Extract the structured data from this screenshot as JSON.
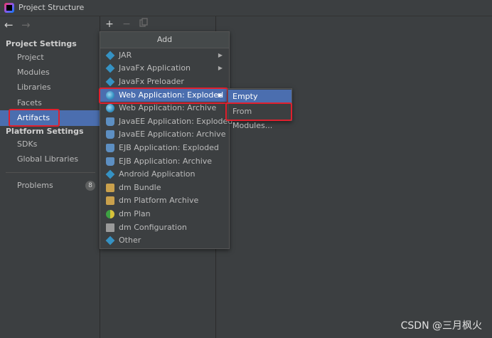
{
  "window": {
    "title": "Project Structure",
    "app_icon": "intellij-idea-icon"
  },
  "nav": {
    "back_icon": "arrow-left-icon",
    "forward_icon": "arrow-right-icon"
  },
  "sidebar": {
    "project_settings_header": "Project Settings",
    "project_items": [
      {
        "label": "Project"
      },
      {
        "label": "Modules"
      },
      {
        "label": "Libraries"
      },
      {
        "label": "Facets"
      },
      {
        "label": "Artifacts",
        "selected": true
      }
    ],
    "platform_settings_header": "Platform Settings",
    "platform_items": [
      {
        "label": "SDKs"
      },
      {
        "label": "Global Libraries"
      }
    ],
    "problems": {
      "label": "Problems",
      "count": "8"
    }
  },
  "toolbar": {
    "add_icon": "+",
    "remove_icon": "−",
    "copy_icon": "copy-icon"
  },
  "add_menu": {
    "title": "Add",
    "items": [
      {
        "label": "JAR",
        "icon": "jar-diamond-icon",
        "has_submenu": true
      },
      {
        "label": "JavaFx Application",
        "icon": "javafx-diamond-icon",
        "has_submenu": true
      },
      {
        "label": "JavaFx Preloader",
        "icon": "javafx-diamond-icon"
      },
      {
        "label": "Web Application: Exploded",
        "icon": "web-globe-icon",
        "has_submenu": true,
        "highlighted": true
      },
      {
        "label": "Web Application: Archive",
        "icon": "web-globe-icon"
      },
      {
        "label": "JavaEE Application: Exploded",
        "icon": "javaee-icon"
      },
      {
        "label": "JavaEE Application: Archive",
        "icon": "javaee-icon"
      },
      {
        "label": "EJB Application: Exploded",
        "icon": "ejb-icon"
      },
      {
        "label": "EJB Application: Archive",
        "icon": "ejb-icon"
      },
      {
        "label": "Android Application",
        "icon": "android-diamond-icon"
      },
      {
        "label": "dm Bundle",
        "icon": "dm-bundle-icon"
      },
      {
        "label": "dm Platform Archive",
        "icon": "dm-platform-icon"
      },
      {
        "label": "dm Plan",
        "icon": "dm-plan-icon"
      },
      {
        "label": "dm Configuration",
        "icon": "dm-configuration-icon"
      },
      {
        "label": "Other",
        "icon": "other-diamond-icon"
      }
    ]
  },
  "submenu": {
    "items": [
      {
        "label": "Empty",
        "highlighted": true
      },
      {
        "label": "From Modules..."
      }
    ]
  },
  "watermark": "CSDN @三月枫火",
  "colors": {
    "selection": "#4b6eaf",
    "annotation": "#e0202e",
    "background": "#3c3f41"
  }
}
